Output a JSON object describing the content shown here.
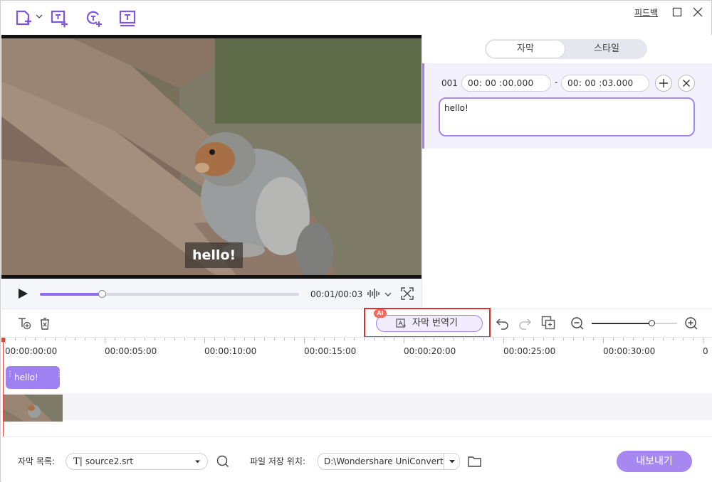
{
  "toolbar": {
    "icons": [
      "add-file-icon",
      "add-subtitle-icon",
      "ai-subtitle-icon",
      "text-subtitle-icon"
    ],
    "feedback_label": "피드백",
    "window_controls": [
      "maximize-icon",
      "close-icon"
    ]
  },
  "video": {
    "overlay_text": "hello!",
    "current_time": "00:01",
    "total_time": "00:03",
    "time_readout": "00:01/00:03",
    "progress_fraction": 0.24
  },
  "right_panel": {
    "tabs": [
      {
        "label": "자막",
        "active": true
      },
      {
        "label": "스타일",
        "active": false
      }
    ],
    "subtitle": {
      "index": "001",
      "start": "00: 00 :00.000",
      "dash": "-",
      "end": "00: 00 :03.000",
      "text": "hello!"
    }
  },
  "midbar": {
    "translate_label": "자막 번역기",
    "ai_badge": "AI",
    "zoom_fraction": 0.7
  },
  "timeline": {
    "ruler": [
      "00:00:00:00",
      "00:00:05:00",
      "00:00:10:00",
      "00:00:15:00",
      "00:00:20:00",
      "00:00:25:00",
      "00:00:30:00",
      "0"
    ],
    "subtitle_clip": "hello!"
  },
  "footer": {
    "subtitle_list_label": "자막 목록:",
    "subtitle_file": "source2.srt",
    "save_location_label": "파일 저장 위치:",
    "save_path": "D:\\Wondershare UniConverter",
    "export_label": "내보내기"
  },
  "colors": {
    "accent": "#9f80f0",
    "highlight_border": "#d9312e",
    "playhead": "#e0463b"
  }
}
